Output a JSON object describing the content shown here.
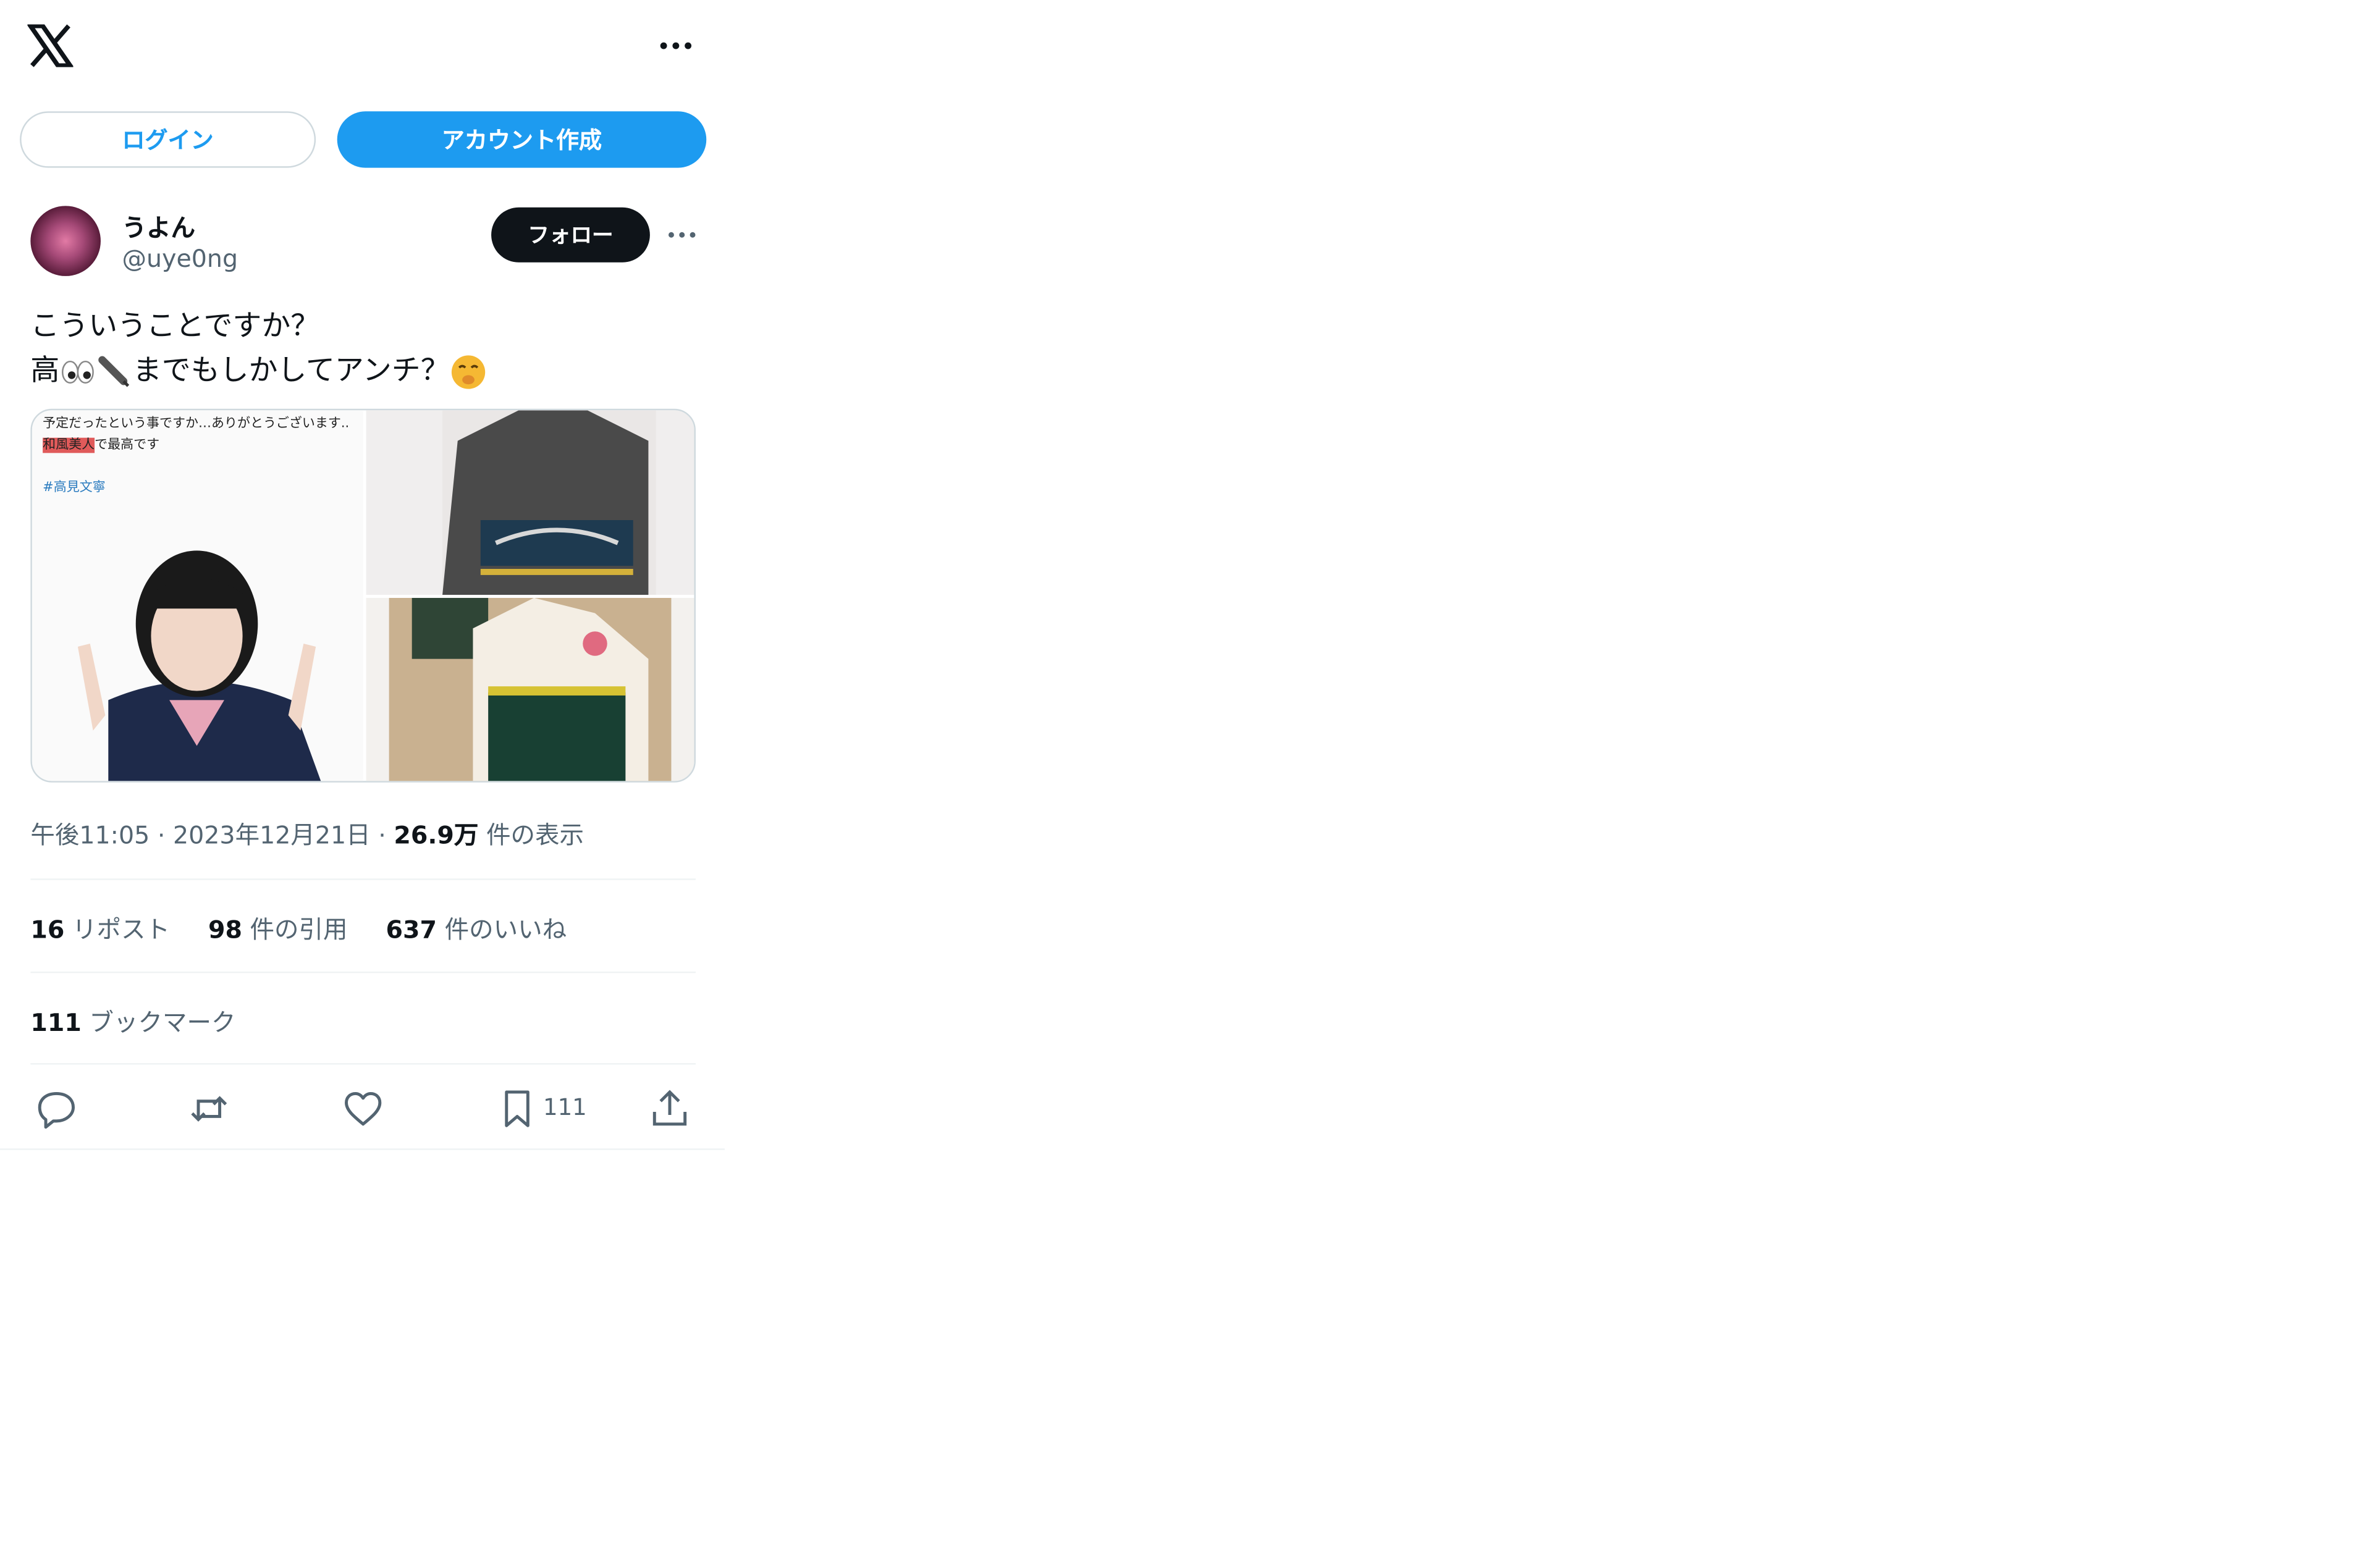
{
  "header": {
    "more_label": "…"
  },
  "auth": {
    "login_label": "ログイン",
    "signup_label": "アカウント作成"
  },
  "tweet": {
    "author_name": "うよん",
    "author_handle": "@uye0ng",
    "follow_label": "フォロー",
    "text_line1": "こういうことですか？",
    "text_line2_start": "高",
    "text_line2_mid": "までもしかしてアンチ？",
    "time": "午後11:05",
    "date": "2023年12月21日",
    "views_count": "26.9万",
    "views_label": "件の表示",
    "meta_sep": "·",
    "media": {
      "caption_before": "予定だったという事ですか…ありがとうございます..",
      "caption_highlight": "和風美人",
      "caption_after": "で最高です",
      "hashtag": "#高見文寧"
    }
  },
  "stats": {
    "reposts_count": "16",
    "reposts_label": "リポスト",
    "quotes_count": "98",
    "quotes_label": "件の引用",
    "likes_count": "637",
    "likes_label": "件のいいね",
    "bookmarks_count": "111",
    "bookmarks_label": "ブックマーク"
  },
  "actions": {
    "bookmark_count": "111"
  },
  "colors": {
    "accent": "#1d9bf0",
    "text": "#0f1419",
    "muted": "#536471",
    "border": "#cfd9de"
  }
}
